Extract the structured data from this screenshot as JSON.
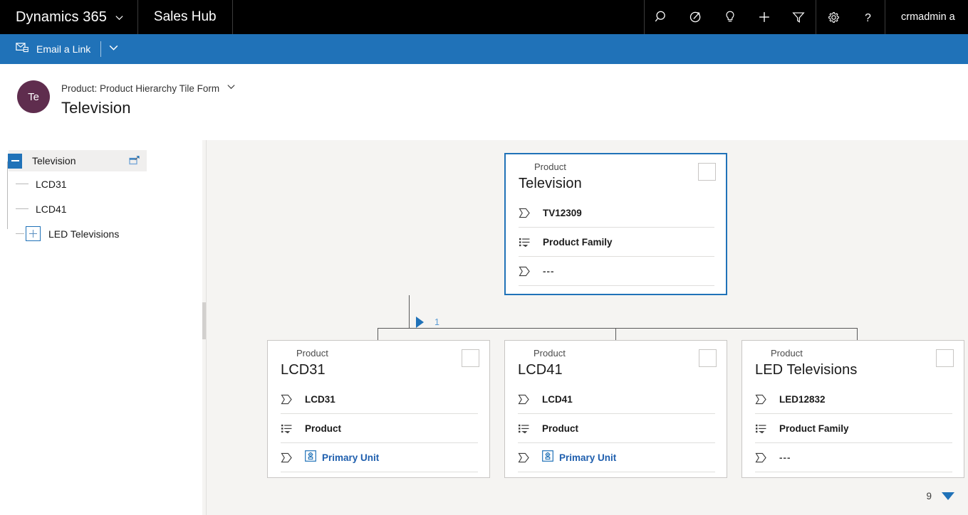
{
  "topbar": {
    "brand": "Dynamics 365",
    "brand_chevron": "chevron-down-icon",
    "app_name": "Sales Hub",
    "icons": [
      {
        "name": "search-icon",
        "title": "Search"
      },
      {
        "name": "assistant-icon",
        "title": "Assistant"
      },
      {
        "name": "lightbulb-icon",
        "title": "Insights"
      },
      {
        "name": "plus-icon",
        "title": "Quick Create"
      },
      {
        "name": "filter-icon",
        "title": "Filter"
      }
    ],
    "icons2": [
      {
        "name": "gear-icon",
        "title": "Settings"
      },
      {
        "name": "help-icon",
        "title": "Help"
      }
    ],
    "user": "crmadmin a"
  },
  "commandbar": {
    "email_link_icon": "email-link-icon",
    "email_link_label": "Email a Link",
    "overflow_icon": "chevron-down-icon"
  },
  "record_header": {
    "avatar_initials": "Te",
    "form_name": "Product: Product Hierarchy Tile Form",
    "form_chevron": "chevron-down-icon",
    "record_title": "Television"
  },
  "tree": {
    "root": {
      "label": "Television",
      "toggle": "minus",
      "selected": true,
      "popout_icon": "open-in-new-window-icon"
    },
    "children": [
      {
        "label": "LCD31",
        "toggle": null
      },
      {
        "label": "LCD41",
        "toggle": null
      },
      {
        "label": "LED Televisions",
        "toggle": "plus"
      }
    ]
  },
  "hierarchy": {
    "parent": {
      "entity": "Product",
      "title": "Television",
      "selected": true,
      "rows": [
        {
          "icon": "text-field-icon",
          "value": "TV12309",
          "type": "text"
        },
        {
          "icon": "option-set-icon",
          "value": "Product Family",
          "type": "text"
        },
        {
          "icon": "text-field-icon",
          "value": "---",
          "type": "empty"
        }
      ]
    },
    "children": [
      {
        "entity": "Product",
        "title": "LCD31",
        "rows": [
          {
            "icon": "text-field-icon",
            "value": "LCD31",
            "type": "text"
          },
          {
            "icon": "option-set-icon",
            "value": "Product",
            "type": "text"
          },
          {
            "icon": "text-field-icon",
            "value": "Primary Unit",
            "type": "lookup",
            "lookup_icon": "unit-lookup-icon"
          }
        ]
      },
      {
        "entity": "Product",
        "title": "LCD41",
        "rows": [
          {
            "icon": "text-field-icon",
            "value": "LCD41",
            "type": "text"
          },
          {
            "icon": "option-set-icon",
            "value": "Product",
            "type": "text"
          },
          {
            "icon": "text-field-icon",
            "value": "Primary Unit",
            "type": "lookup",
            "lookup_icon": "unit-lookup-icon"
          }
        ]
      },
      {
        "entity": "Product",
        "title": "LED Televisions",
        "rows": [
          {
            "icon": "text-field-icon",
            "value": "LED12832",
            "type": "text"
          },
          {
            "icon": "option-set-icon",
            "value": "Product Family",
            "type": "text"
          },
          {
            "icon": "text-field-icon",
            "value": "---",
            "type": "empty"
          }
        ]
      }
    ],
    "connector_badge": "1",
    "connector_arrow_icon": "expand-right-arrow-icon"
  },
  "pager": {
    "count": "9",
    "caret_icon": "caret-down-icon"
  },
  "colors": {
    "topbar_bg": "#000000",
    "commandbar_bg": "#2072b8",
    "accent": "#2072b8",
    "canvas_bg": "#f5f4f2",
    "avatar_bg": "#5f2d4e",
    "link": "#1f5fae",
    "connector": "#595959"
  }
}
